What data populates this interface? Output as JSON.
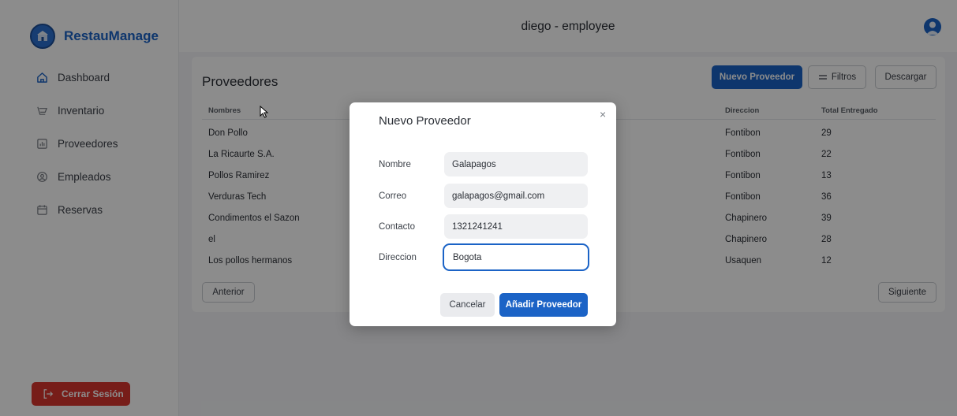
{
  "app": {
    "name": "RestauManage"
  },
  "header": {
    "title": "diego - employee"
  },
  "sidebar": {
    "items": [
      {
        "label": "Dashboard",
        "icon": "home-icon"
      },
      {
        "label": "Inventario",
        "icon": "inventory-icon"
      },
      {
        "label": "Proveedores",
        "icon": "chart-icon"
      },
      {
        "label": "Empleados",
        "icon": "user-circle-icon"
      },
      {
        "label": "Reservas",
        "icon": "calendar-icon"
      }
    ],
    "logout_label": "Cerrar Sesión"
  },
  "page": {
    "title": "Proveedores",
    "new_button": "Nuevo Proveedor",
    "filter_button": "Filtros",
    "download_button": "Descargar",
    "prev_button": "Anterior",
    "next_button": "Siguiente"
  },
  "table": {
    "columns": [
      "Nombres",
      "Direccion",
      "Total Entregado"
    ],
    "rows": [
      {
        "nombre": "Don Pollo",
        "direccion": "Fontibon",
        "total": "29"
      },
      {
        "nombre": "La Ricaurte S.A.",
        "direccion": "Fontibon",
        "total": "22"
      },
      {
        "nombre": "Pollos Ramirez",
        "direccion": "Fontibon",
        "total": "13"
      },
      {
        "nombre": "Verduras Tech",
        "direccion": "Fontibon",
        "total": "36"
      },
      {
        "nombre": "Condimentos el Sazon",
        "direccion": "Chapinero",
        "total": "39"
      },
      {
        "nombre": "el",
        "direccion": "Chapinero",
        "total": "28"
      },
      {
        "nombre": "Los pollos hermanos",
        "direccion": "Usaquen",
        "total": "12"
      }
    ]
  },
  "modal": {
    "title": "Nuevo Proveedor",
    "close": "×",
    "fields": [
      {
        "label": "Nombre",
        "value": "Galapagos"
      },
      {
        "label": "Correo",
        "value": "galapagos@gmail.com"
      },
      {
        "label": "Contacto",
        "value": "1321241241"
      },
      {
        "label": "Direccion",
        "value": "Bogota"
      }
    ],
    "cancel_button": "Cancelar",
    "submit_button": "Añadir Proveedor"
  },
  "colors": {
    "primary": "#1b63c6",
    "danger": "#d9362e",
    "overlay": "rgba(0,0,0,0.45)"
  }
}
